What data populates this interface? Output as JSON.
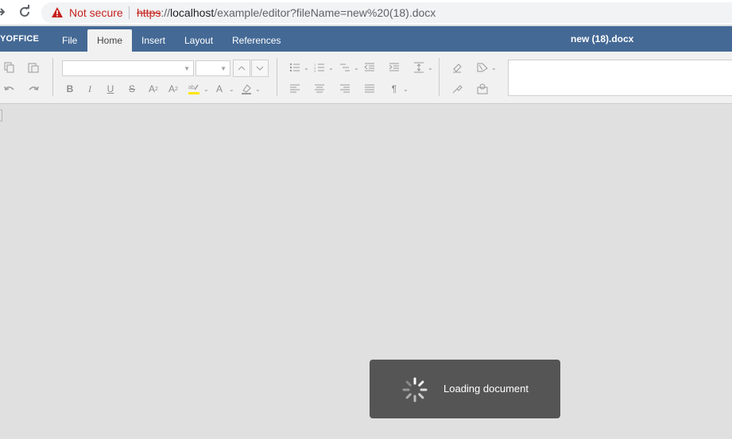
{
  "browser": {
    "security_label": "Not secure",
    "url_scheme": "https",
    "url_scheme_sep": "://",
    "url_host": "localhost",
    "url_path": "/example/editor?fileName=new%20(18).docx"
  },
  "editor": {
    "brand": "YOFFICE",
    "tabs": [
      {
        "label": "File",
        "active": false
      },
      {
        "label": "Home",
        "active": true
      },
      {
        "label": "Insert",
        "active": false
      },
      {
        "label": "Layout",
        "active": false
      },
      {
        "label": "References",
        "active": false
      }
    ],
    "document_title": "new (18).docx"
  },
  "toolbar": {
    "font_name": "",
    "font_size": "",
    "icons": [
      "copy-icon",
      "paste-icon",
      "undo-icon",
      "redo-icon",
      "bold-icon",
      "italic-icon",
      "underline-icon",
      "strikethrough-icon",
      "superscript-icon",
      "subscript-icon",
      "highlight-icon",
      "font-color-icon",
      "shading-icon",
      "bullets-icon",
      "numbering-icon",
      "multilevel-icon",
      "decrease-indent-icon",
      "increase-indent-icon",
      "line-spacing-icon",
      "align-left-icon",
      "align-center-icon",
      "align-right-icon",
      "justify-icon",
      "paragraph-mark-icon",
      "clear-style-icon",
      "copy-style-icon",
      "color-scheme-icon",
      "mail-merge-icon"
    ]
  },
  "loader": {
    "text": "Loading document"
  },
  "colors": {
    "header_bg": "#446995",
    "toolbar_bg": "#f1f1f1",
    "canvas_bg": "#e0e0e0",
    "loader_bg": "#555555",
    "warning_red": "#c5221f",
    "highlight_yellow": "#ffe500"
  }
}
